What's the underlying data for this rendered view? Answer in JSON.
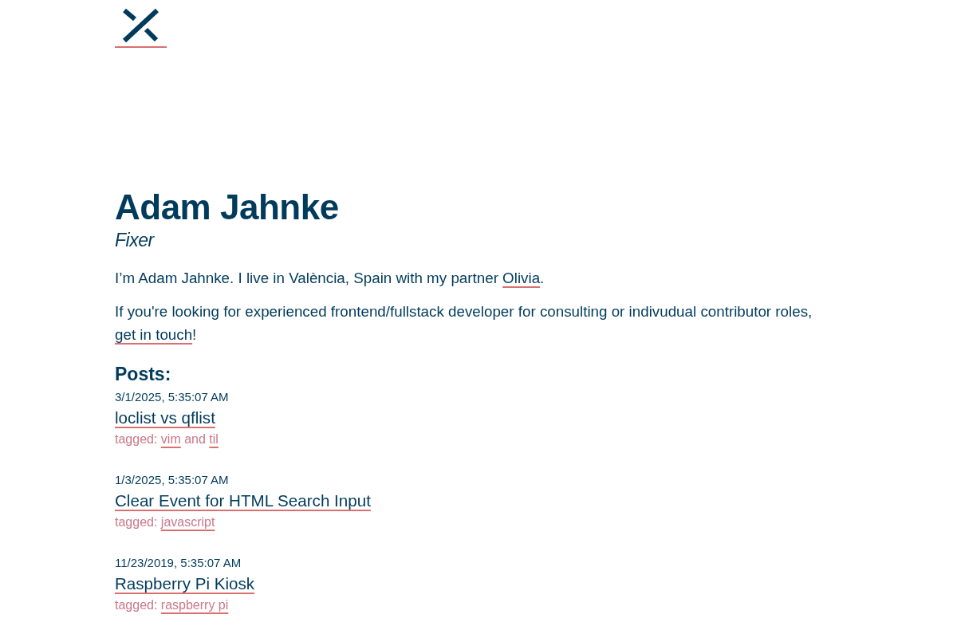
{
  "profile": {
    "name": "Adam Jahnke",
    "role": "Fixer"
  },
  "paragraphs": [
    {
      "parts": [
        {
          "kind": "text",
          "text": "I’m Adam Jahnke. I live in València, Spain with my partner "
        },
        {
          "kind": "link",
          "text": "Olivia"
        },
        {
          "kind": "text",
          "text": "."
        }
      ]
    },
    {
      "parts": [
        {
          "kind": "text",
          "text": "If you're looking for experienced frontend/fullstack developer for consulting or indivudual contributor roles, "
        },
        {
          "kind": "link",
          "text": "get in touch"
        },
        {
          "kind": "text",
          "text": "!"
        }
      ]
    }
  ],
  "posts_heading": "Posts:",
  "posts": [
    {
      "date": "3/1/2025, 5:35:07 AM",
      "title": "loclist vs qflist",
      "tags": [
        {
          "kind": "text",
          "text": "tagged:"
        },
        {
          "kind": "link",
          "text": "vim"
        },
        {
          "kind": "text",
          "text": "and"
        },
        {
          "kind": "link",
          "text": "til"
        }
      ]
    },
    {
      "date": "1/3/2025, 5:35:07 AM",
      "title": "Clear Event for HTML Search Input",
      "tags": [
        {
          "kind": "text",
          "text": "tagged:"
        },
        {
          "kind": "link",
          "text": "javascript"
        }
      ]
    },
    {
      "date": "11/23/2019, 5:35:07 AM",
      "title": "Raspberry Pi Kiosk",
      "tags": [
        {
          "kind": "text",
          "text": "tagged:"
        },
        {
          "kind": "link",
          "text": "raspberry pi"
        }
      ]
    }
  ]
}
